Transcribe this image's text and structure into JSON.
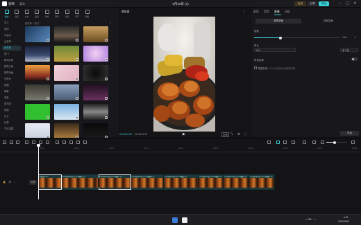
{
  "titlebar": {
    "app_name": "剪映",
    "menu_label": "菜单",
    "project_title": "6月26日 (3)",
    "member_label": "会员",
    "share_label": "分享",
    "export_label": "导出"
  },
  "left_panel": {
    "tool_tabs": [
      {
        "label": "媒体",
        "icon": "media-icon",
        "active": true
      },
      {
        "label": "音频",
        "icon": "audio-icon",
        "active": false
      },
      {
        "label": "文本",
        "icon": "text-icon",
        "active": false
      },
      {
        "label": "贴纸",
        "icon": "sticker-icon",
        "active": false
      },
      {
        "label": "特效",
        "icon": "effects-icon",
        "active": false
      },
      {
        "label": "转场",
        "icon": "transition-icon",
        "active": false
      },
      {
        "label": "滤镜",
        "icon": "filter-icon",
        "active": false
      },
      {
        "label": "调节",
        "icon": "adjust-icon",
        "active": false
      },
      {
        "label": "模板",
        "icon": "template-icon",
        "active": false
      }
    ],
    "categories": [
      {
        "label": "导入",
        "active": false
      },
      {
        "label": "我的",
        "active": false
      },
      {
        "label": "AI生成",
        "active": false
      },
      {
        "label": "云素材",
        "active": false
      },
      {
        "label": "素材库",
        "active": true
      },
      {
        "label": "热门",
        "active": false
      },
      {
        "label": "转场片段",
        "active": false
      },
      {
        "label": "搞笑片段",
        "active": false
      },
      {
        "label": "故障动画",
        "active": false
      },
      {
        "label": "空镜头",
        "active": false
      },
      {
        "label": "氛围",
        "active": false
      },
      {
        "label": "绿幕",
        "active": false
      },
      {
        "label": "背景",
        "active": false
      },
      {
        "label": "蒸汽波",
        "active": false
      },
      {
        "label": "情绪",
        "active": false
      },
      {
        "label": "片头",
        "active": false
      },
      {
        "label": "片尾",
        "active": false
      },
      {
        "label": "节日氛围",
        "active": false
      }
    ],
    "breadcrumb": "素材库 > 热门"
  },
  "player": {
    "header": "播放器",
    "current_time": "00:00:00:00",
    "total_time": "00:03:21:00",
    "ratio_label": "比例"
  },
  "right_panel": {
    "tabs": [
      {
        "label": "画面",
        "active": false
      },
      {
        "label": "音频",
        "active": false
      },
      {
        "label": "变速",
        "active": true
      },
      {
        "label": "动画",
        "active": false
      }
    ],
    "subtabs": [
      {
        "label": "常规变速",
        "active": true
      },
      {
        "label": "曲线变速",
        "active": false
      }
    ],
    "speed_label": "倍数",
    "speed_value": "1.0x",
    "duration_label": "时长",
    "duration_value": "5.0s",
    "duration_unit": "多个值",
    "pitch_label": "声音变调",
    "smooth_label": "智能补帧",
    "smooth_hint": "可以让变速后画面更流畅",
    "export_button": "导出"
  },
  "timeline": {
    "track_label": "封面",
    "ruler_ticks": [
      "00:00",
      "|00:05",
      "|00:10",
      "|00:15",
      "|00:20",
      "|00:25",
      "|00:30",
      "|00:35",
      "|00:40",
      "|00:45"
    ],
    "clips": [
      "1.9倍速 0.81s",
      "2023年6月26日 24:00 A视频 1.0x",
      "2023年6月26日 24:00 A视频 1.0x",
      "2023年6月26日 24:00 A视频 1.0x",
      "2023年6月26日 24:00 A视频 1.0x",
      "2023年6月26日 24:00 A视频 1.0x",
      "2023年6月26日 24:00 A视频 1.0x",
      "2023年6月26日 24:00 A视频 1.0x"
    ]
  },
  "taskbar": {
    "time": "4:18",
    "date": "2023/06/26"
  },
  "colors": {
    "accent": "#38d0d8",
    "member_badge": "#d8b36a",
    "track_bg": "#1c3a3e"
  }
}
